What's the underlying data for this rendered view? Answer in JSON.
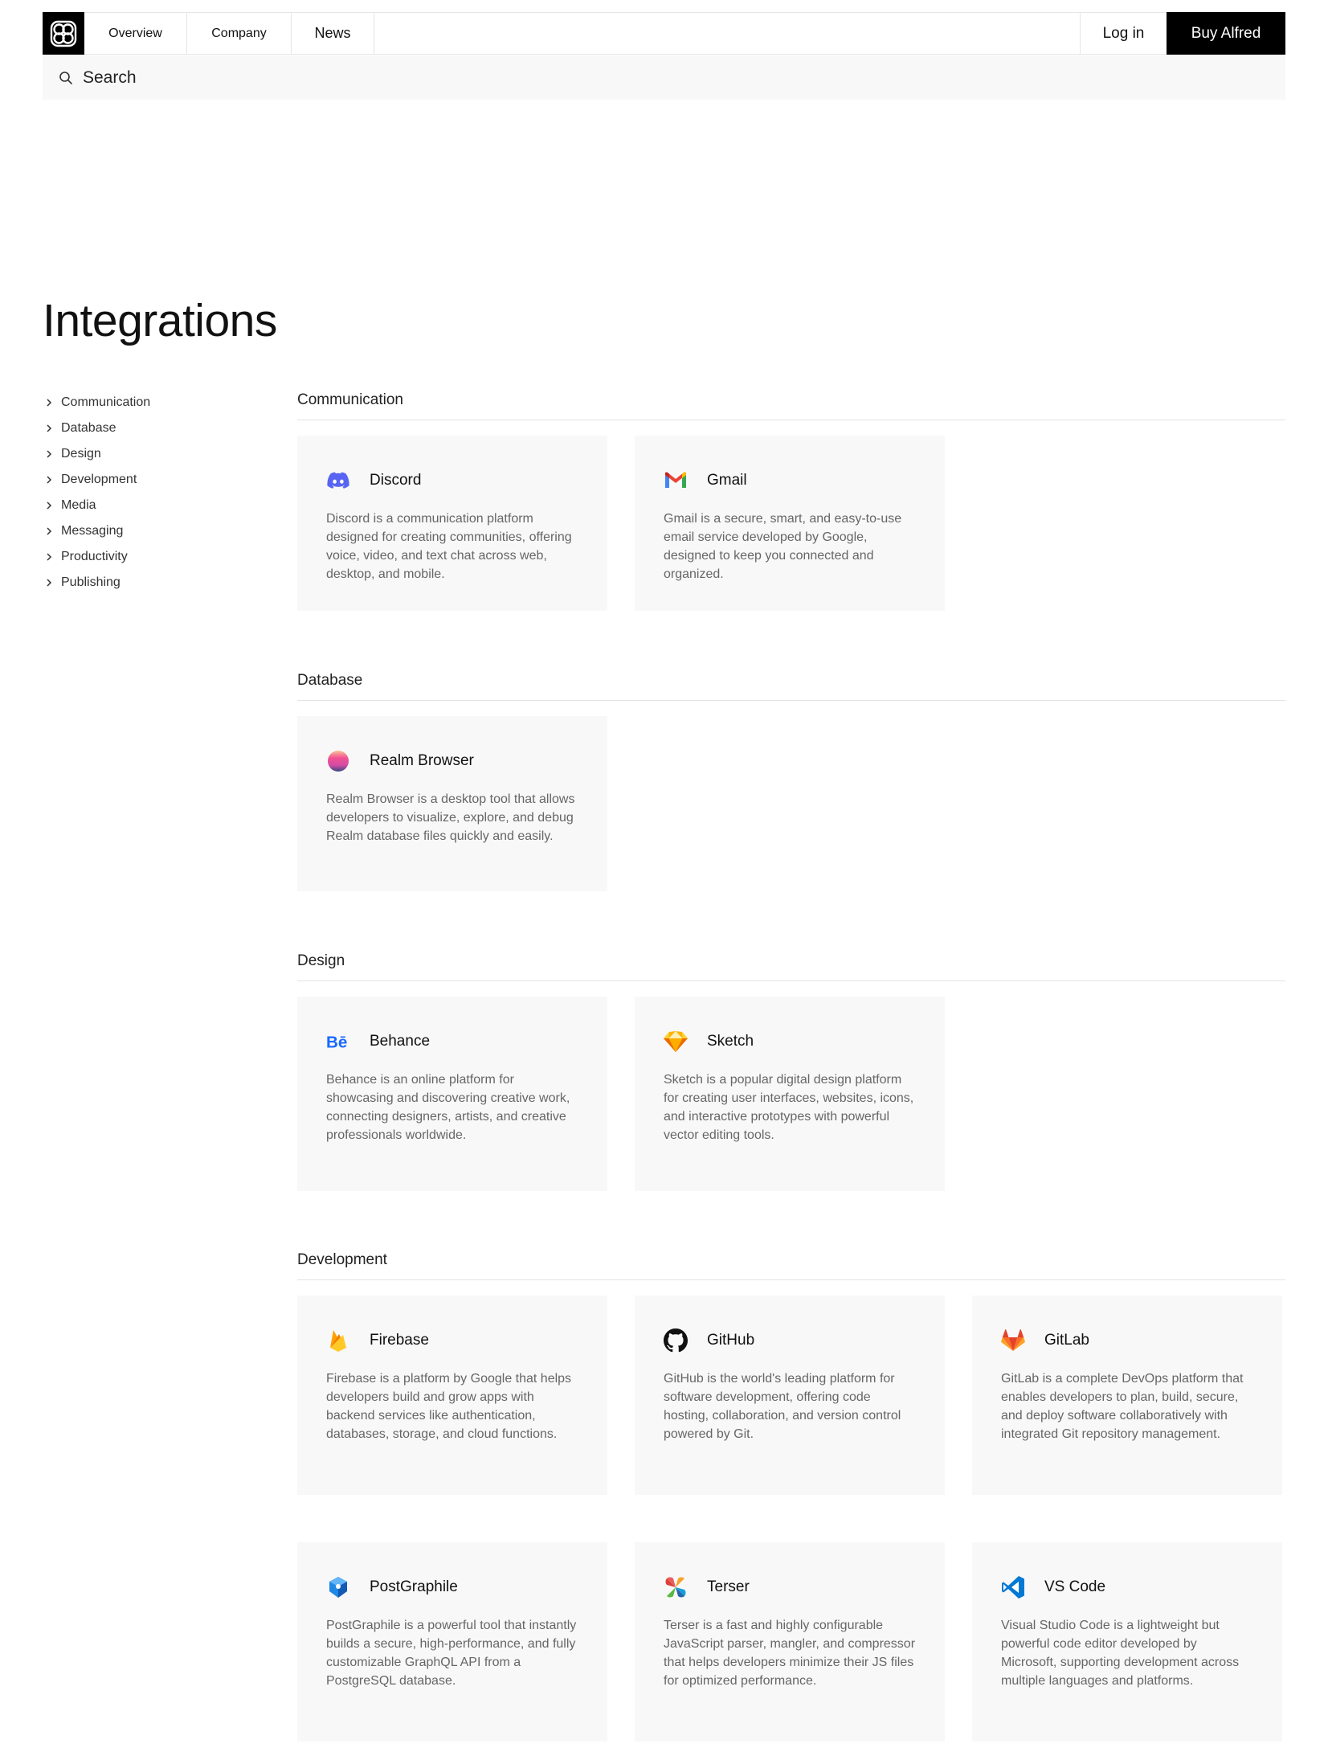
{
  "nav": {
    "tabs": [
      "Overview",
      "Company",
      "News"
    ],
    "login_label": "Log in",
    "buy_label": "Buy Alfred"
  },
  "search": {
    "label": "Search"
  },
  "page": {
    "title": "Integrations"
  },
  "sidebar": {
    "items": [
      {
        "label": "Communication"
      },
      {
        "label": "Database"
      },
      {
        "label": "Design"
      },
      {
        "label": "Development"
      },
      {
        "label": "Media"
      },
      {
        "label": "Messaging"
      },
      {
        "label": "Productivity"
      },
      {
        "label": "Publishing"
      }
    ]
  },
  "sections": {
    "communication": {
      "title": "Communication",
      "cards": [
        {
          "name": "Discord",
          "icon": "discord-icon",
          "desc": "Discord is a communication platform designed for creating communities, offering voice, video, and text chat across web, desktop, and mobile."
        },
        {
          "name": "Gmail",
          "icon": "gmail-icon",
          "desc": "Gmail is a secure, smart, and easy-to-use email service developed by Google, designed to keep you connected and organized."
        }
      ]
    },
    "database": {
      "title": "Database",
      "cards": [
        {
          "name": "Realm Browser",
          "icon": "realm-icon",
          "desc": "Realm Browser is a desktop tool that allows developers to visualize, explore, and debug Realm database files quickly and easily."
        }
      ]
    },
    "design": {
      "title": "Design",
      "cards": [
        {
          "name": "Behance",
          "icon": "behance-icon",
          "desc": "Behance is an online platform for showcasing and discovering creative work, connecting designers, artists, and creative professionals worldwide."
        },
        {
          "name": "Sketch",
          "icon": "sketch-icon",
          "desc": "Sketch is a popular digital design platform for creating user interfaces, websites, icons, and interactive prototypes with powerful vector editing tools."
        }
      ]
    },
    "development": {
      "title": "Development",
      "cards": [
        {
          "name": "Firebase",
          "icon": "firebase-icon",
          "desc": "Firebase is a platform by Google that helps developers build and grow apps with backend services like authentication, databases, storage, and cloud functions."
        },
        {
          "name": "GitHub",
          "icon": "github-icon",
          "desc": "GitHub is the world's leading platform for software development, offering code hosting, collaboration, and version control powered by Git."
        },
        {
          "name": "GitLab",
          "icon": "gitlab-icon",
          "desc": "GitLab is a complete DevOps platform that enables developers to plan, build, secure, and deploy software collaboratively with integrated Git repository management."
        },
        {
          "name": "PostGraphile",
          "icon": "postgraphile-icon",
          "desc": "PostGraphile is a powerful tool that instantly builds a secure, high-performance, and fully customizable GraphQL API from a PostgreSQL database."
        },
        {
          "name": "Terser",
          "icon": "terser-icon",
          "desc": "Terser is a fast and highly configurable JavaScript parser, mangler, and compressor that helps developers minimize their JS files for optimized performance."
        },
        {
          "name": "VS Code",
          "icon": "vscode-icon",
          "desc": "Visual Studio Code is a lightweight but powerful code editor developed by Microsoft, supporting development across multiple languages and platforms."
        }
      ]
    }
  },
  "colors": {
    "brand_black": "#000000",
    "card_bg": "#f8f8f8",
    "discord": "#5865F2",
    "behance": "#1769FF",
    "vscode": "#0078D4"
  }
}
